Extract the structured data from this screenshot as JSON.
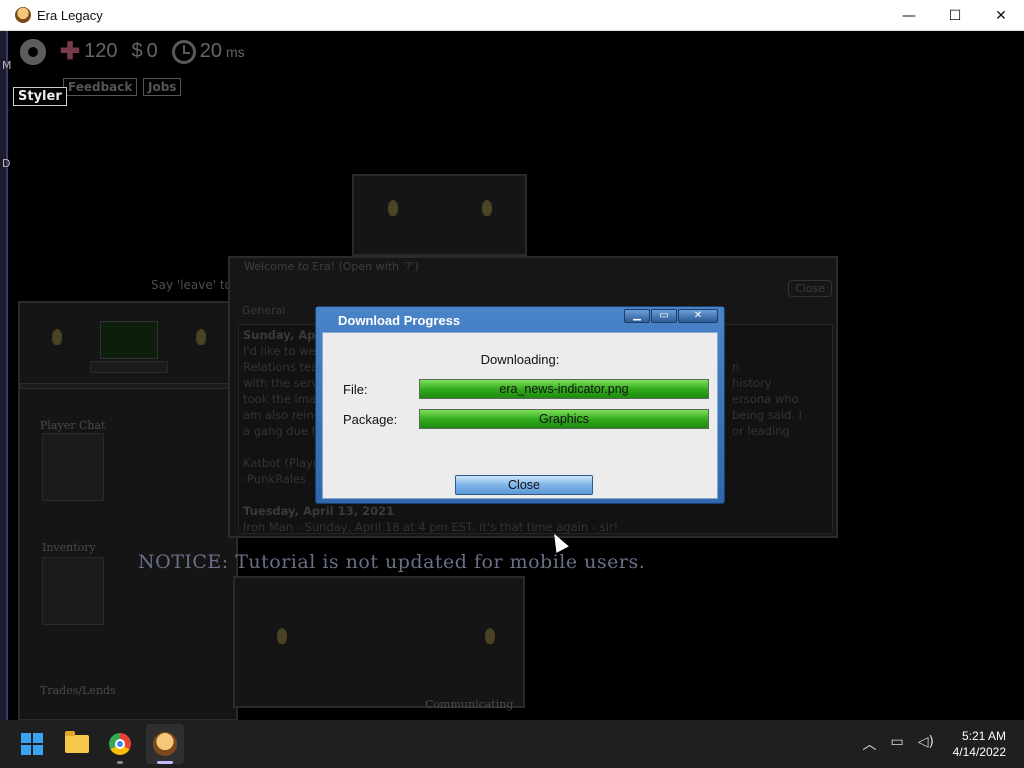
{
  "window": {
    "title": "Era Legacy",
    "controls": {
      "minimize": "—",
      "maximize": "☐",
      "close": "✕"
    }
  },
  "left_strip": {
    "letter1": "M",
    "letter2": "D"
  },
  "hud": {
    "health": "120",
    "money_symbol": "$",
    "money": "0",
    "ping": "20",
    "ping_unit": "ms"
  },
  "buttons": {
    "styler": "Styler",
    "feedback": "Feedback",
    "jobs": "Jobs"
  },
  "game_text": {
    "say_leave": "Say 'leave' to",
    "player_chat": "Player Chat",
    "inventory": "Inventory",
    "trades": "Trades/Lends",
    "communicating": "Communicating",
    "notice": "NOTICE: Tutorial is not updated for mobile users."
  },
  "welcome": {
    "title": "Welcome to Era! (Open with '?')",
    "close": "Close",
    "tab": "General",
    "news_date1": "Sunday, April",
    "news_line1": "I'd like to welc",
    "news_line2": "Relations tea",
    "news_line3": "with the serve",
    "news_line4": "took the ima",
    "news_line5": "am also reinc",
    "news_line6": "a gang due t",
    "news_right1": "n",
    "news_right2": "history",
    "news_right3": "ersona who",
    "news_right4": "being said. I",
    "news_right5": "or leading",
    "news_sign": "Katbot (Playe",
    "news_sign2": "-PunkRales",
    "news_date2": "Tuesday, April 13, 2021",
    "news_line7": "Iron Man - Sunday, April 18 at 4 pm EST. It's that time again - sir!"
  },
  "dialog": {
    "title": "Download Progress",
    "caption": "Downloading:",
    "file_label": "File:",
    "file_value": "era_news-indicator.png",
    "file_progress": 1.0,
    "package_label": "Package:",
    "package_value": "Graphics",
    "package_progress": 1.0,
    "close_button": "Close",
    "ctrl_min": "▁",
    "ctrl_max": "▭",
    "ctrl_close": "✕"
  },
  "taskbar": {
    "time": "5:21 AM",
    "date": "4/14/2022",
    "tray_up": "︿",
    "tray_net": "▭",
    "tray_vol": "◁)"
  }
}
